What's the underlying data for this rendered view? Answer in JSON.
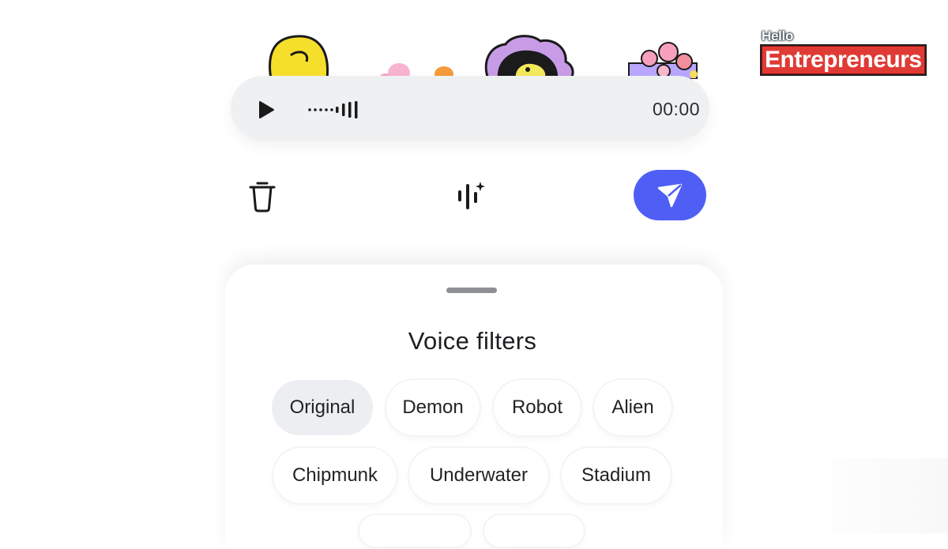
{
  "audio_player": {
    "duration": "00:00",
    "play_icon": "play-icon",
    "waveform_icon": "waveform-icon"
  },
  "actions": {
    "delete_icon": "trash-icon",
    "filter_icon": "voice-filter-sparkle-icon",
    "send_icon": "send-icon"
  },
  "voice_filters": {
    "title": "Voice filters",
    "options": [
      {
        "label": "Original",
        "selected": true
      },
      {
        "label": "Demon",
        "selected": false
      },
      {
        "label": "Robot",
        "selected": false
      },
      {
        "label": "Alien",
        "selected": false
      },
      {
        "label": "Chipmunk",
        "selected": false
      },
      {
        "label": "Underwater",
        "selected": false
      },
      {
        "label": "Stadium",
        "selected": false
      }
    ]
  },
  "watermark": {
    "line1": "Hello",
    "line2": "Entrepreneurs"
  },
  "colors": {
    "accent": "#4f5ff5",
    "brand_red": "#e03a35",
    "chip_selected": "#eceef1"
  }
}
